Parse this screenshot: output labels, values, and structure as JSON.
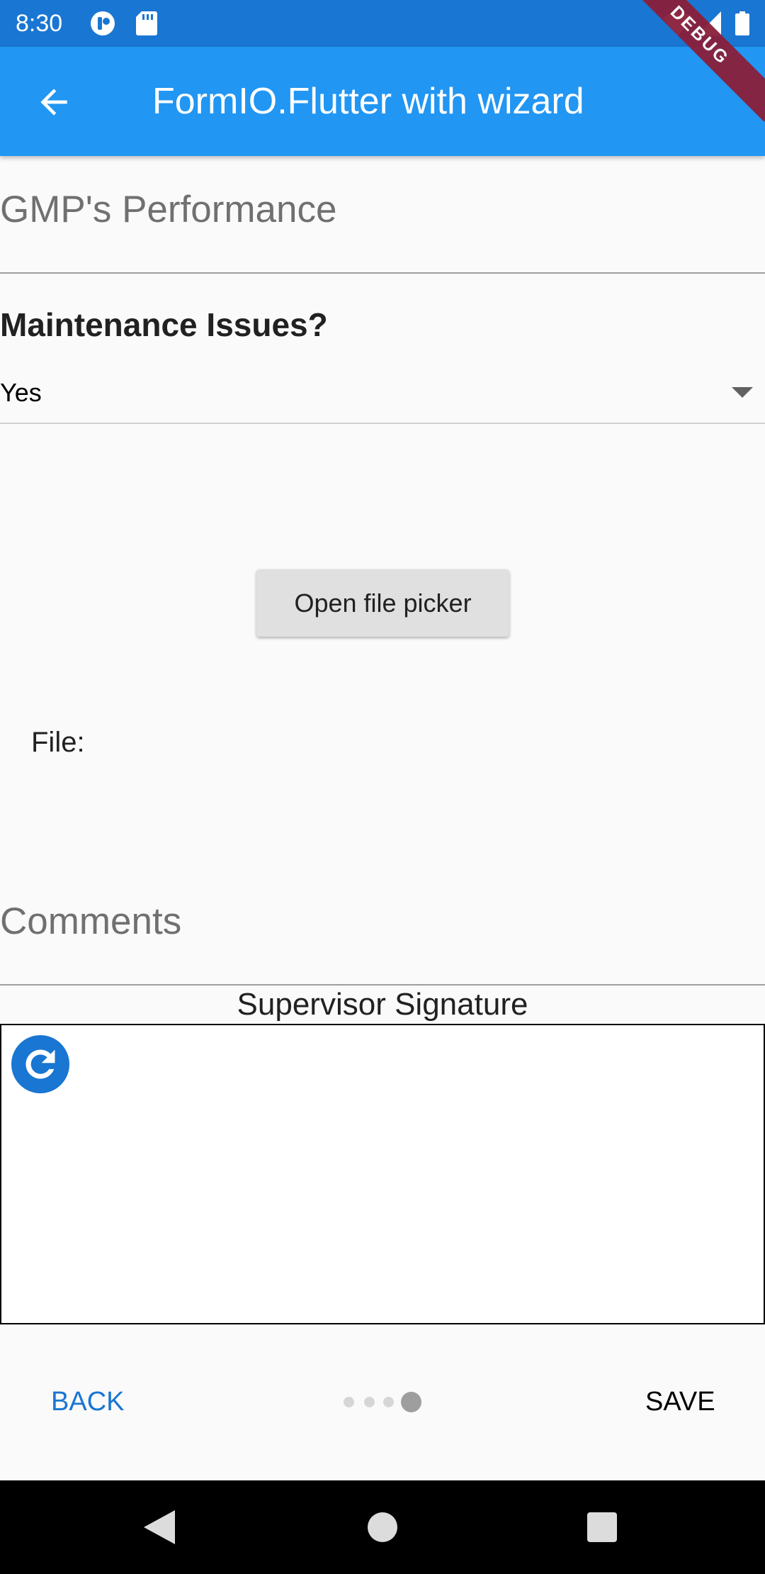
{
  "status_bar": {
    "time": "8:30",
    "icons": [
      "notification-app-icon",
      "sd-card-icon",
      "wifi-icon",
      "signal-icon",
      "battery-icon"
    ]
  },
  "app_bar": {
    "title": "FormIO.Flutter with wizard",
    "back_icon": "arrow-back-icon",
    "color": "#2196f3"
  },
  "debug_banner": {
    "label": "DEBUG",
    "color": "#8a1f3a"
  },
  "form": {
    "performance_heading": "GMP's Performance",
    "maintenance": {
      "label": "Maintenance Issues?",
      "selected_value": "Yes"
    },
    "file_picker": {
      "button_label": "Open file picker",
      "file_label": "File:"
    },
    "comments_heading": "Comments",
    "signature": {
      "label": "Supervisor Signature",
      "reset_icon": "refresh-icon"
    }
  },
  "stepper": {
    "back_label": "BACK",
    "save_label": "SAVE",
    "total_steps": 4,
    "current_step": 4,
    "accent_color": "#1976d2"
  },
  "nav_bar": {
    "icons": [
      "nav-back-icon",
      "nav-home-icon",
      "nav-recents-icon"
    ]
  }
}
